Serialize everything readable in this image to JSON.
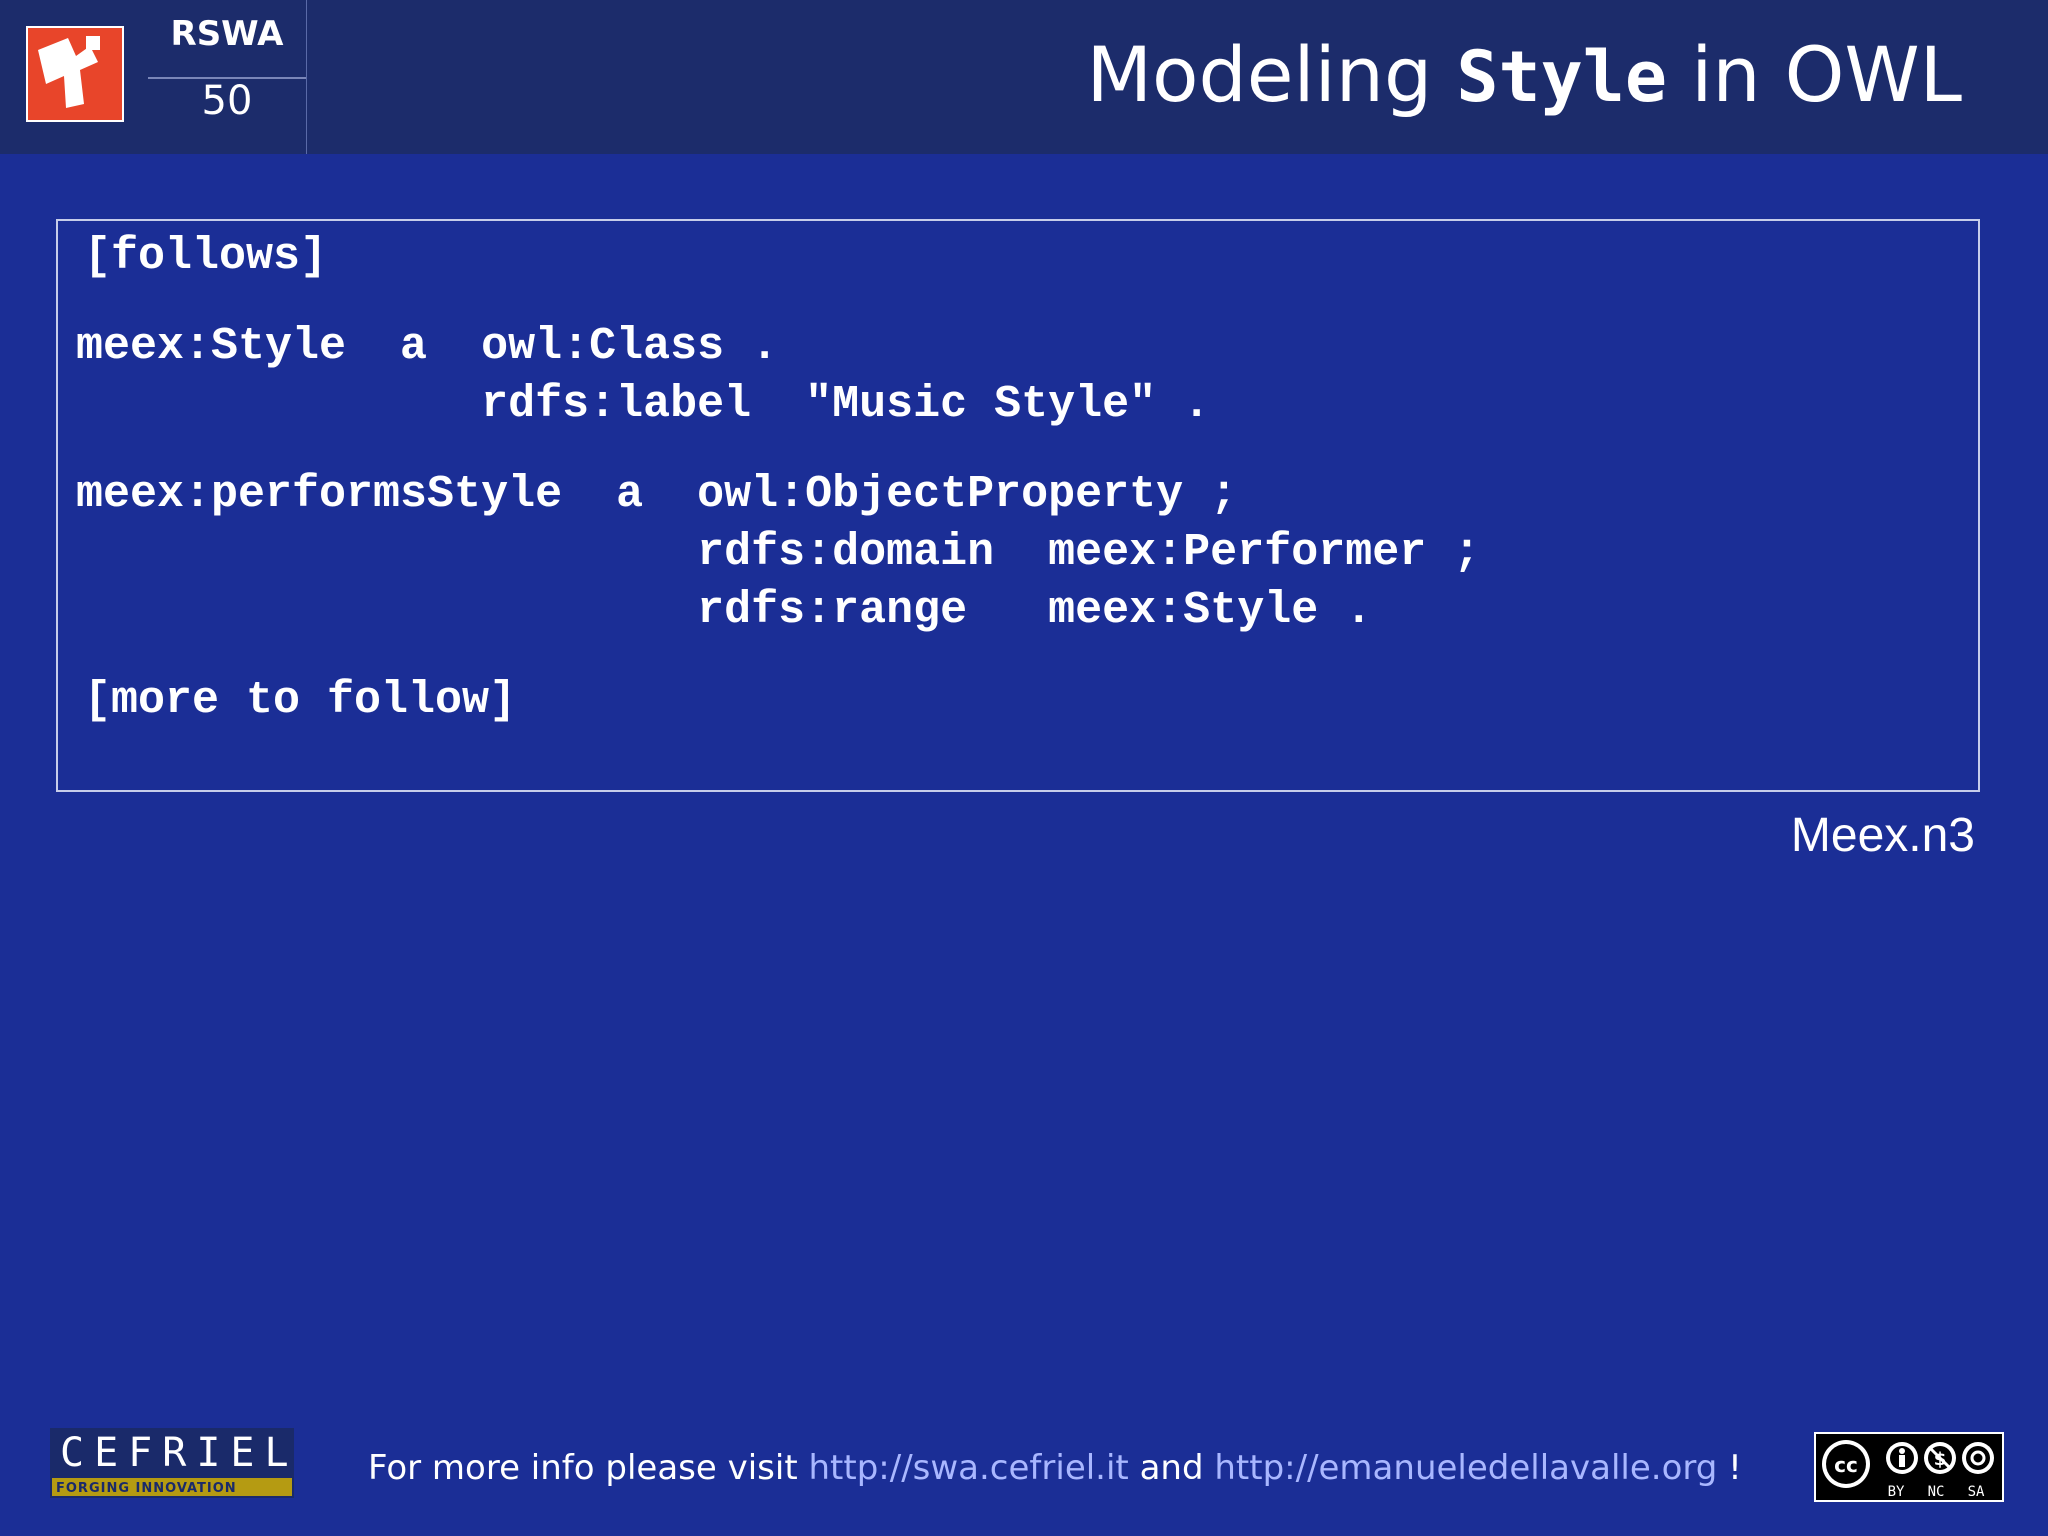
{
  "header": {
    "course_code": "RSWA",
    "slide_number": "50",
    "title_prefix": "Modeling ",
    "title_code": "Style",
    "title_suffix": " in OWL"
  },
  "code": {
    "lines": [
      "[follows]",
      "meex:Style  a  owl:Class .",
      "               rdfs:label  \"Music Style\" .",
      "meex:performsStyle  a  owl:ObjectProperty ;",
      "                       rdfs:domain  meex:Performer ;",
      "                       rdfs:range   meex:Style .",
      "[more to follow]"
    ]
  },
  "filename": "Meex.n3",
  "footer": {
    "text_prefix": "For more info please visit ",
    "link1": "http://swa.cefriel.it",
    "text_middle": " and ",
    "link2": "http://emanueledellavalle.org",
    "text_suffix": " !"
  },
  "cefriel_logo": {
    "wordmark": "CEFRIEL",
    "tagline": "FORGING INNOVATION"
  },
  "license_badge": {
    "labels": [
      "BY",
      "NC",
      "SA"
    ]
  }
}
